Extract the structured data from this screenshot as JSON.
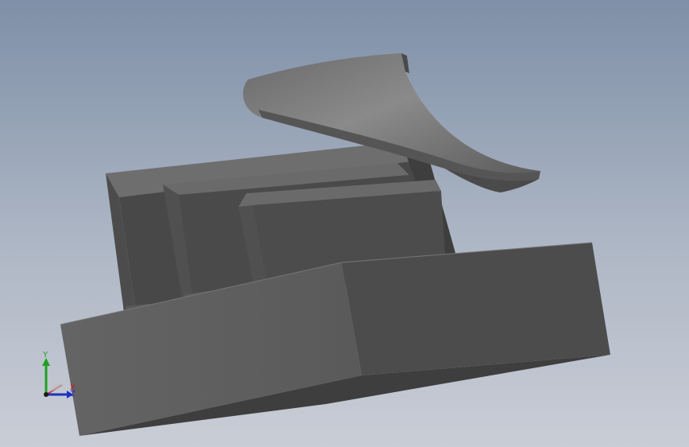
{
  "viewport": {
    "background_top": "#7e8fa7",
    "background_bottom": "#c9cdd6"
  },
  "model": {
    "parts": [
      "base-block",
      "back-plate",
      "fin-tall",
      "fin-middle",
      "fin-short",
      "curved-blade"
    ],
    "face_colors": {
      "front": "#5c5c5c",
      "side": "#4a4a4a",
      "top": "#6e6e6e",
      "dark": "#3c3c3c",
      "blade_top": "#777777",
      "blade_edge": "#555555"
    }
  },
  "triad": {
    "x_label": "X",
    "y_label": "Y",
    "z_label": "Z",
    "x_color": "#c02020",
    "y_color": "#20a020",
    "z_color": "#2030c0"
  }
}
